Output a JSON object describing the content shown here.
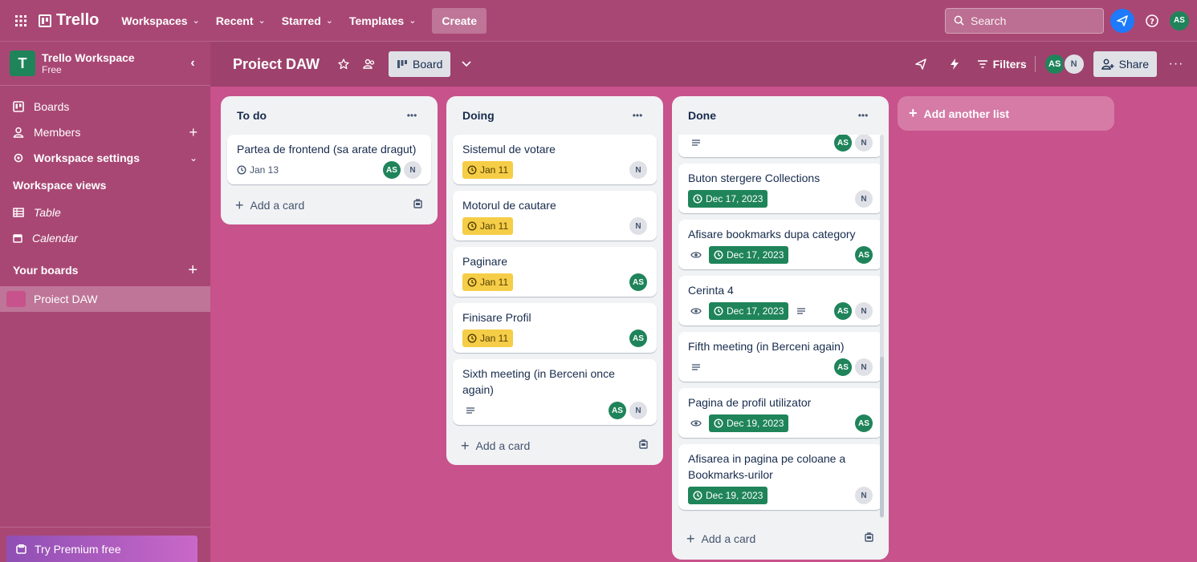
{
  "topbar": {
    "logo": "Trello",
    "nav": [
      "Workspaces",
      "Recent",
      "Starred",
      "Templates"
    ],
    "create_label": "Create",
    "search_placeholder": "Search",
    "user_initials": "AS"
  },
  "sidebar": {
    "workspace_name": "Trello Workspace",
    "workspace_plan": "Free",
    "workspace_initial": "T",
    "items": [
      {
        "label": "Boards",
        "icon": "trello-board-icon"
      },
      {
        "label": "Members",
        "icon": "person-icon"
      },
      {
        "label": "Workspace settings",
        "icon": "gear-icon"
      }
    ],
    "views_heading": "Workspace views",
    "views": [
      {
        "label": "Table",
        "icon": "table-icon"
      },
      {
        "label": "Calendar",
        "icon": "calendar-icon"
      }
    ],
    "boards_heading": "Your boards",
    "boards": [
      {
        "label": "Proiect DAW"
      }
    ],
    "premium_label": "Try Premium free"
  },
  "board": {
    "title": "Proiect DAW",
    "view_label": "Board",
    "filters_label": "Filters",
    "members": [
      "AS",
      "N"
    ],
    "share_label": "Share"
  },
  "lists": [
    {
      "title": "To do",
      "cards": [
        {
          "title": "Partea de frontend (sa arate dragut)",
          "date": "Jan 13",
          "date_style": "plain",
          "members": [
            "AS",
            "N"
          ]
        }
      ],
      "add_label": "Add a card"
    },
    {
      "title": "Doing",
      "cards": [
        {
          "title": "Sistemul de votare",
          "date": "Jan 11",
          "date_style": "due-soon",
          "members": [
            "N"
          ]
        },
        {
          "title": "Motorul de cautare",
          "date": "Jan 11",
          "date_style": "due-soon",
          "members": [
            "N"
          ]
        },
        {
          "title": "Paginare",
          "date": "Jan 11",
          "date_style": "due-soon",
          "members": [
            "AS"
          ]
        },
        {
          "title": "Finisare Profil",
          "date": "Jan 11",
          "date_style": "due-soon",
          "members": [
            "AS"
          ]
        },
        {
          "title": "Sixth meeting (in Berceni once again)",
          "description": true,
          "members": [
            "AS",
            "N"
          ]
        }
      ],
      "add_label": "Add a card"
    },
    {
      "title": "Done",
      "cards": [
        {
          "title": "",
          "description": true,
          "members": [
            "AS",
            "N"
          ]
        },
        {
          "title": "Buton stergere Collections",
          "date": "Dec 17, 2023",
          "date_style": "complete",
          "members": [
            "N"
          ]
        },
        {
          "title": "Afisare bookmarks dupa category",
          "watch": true,
          "date": "Dec 17, 2023",
          "date_style": "complete",
          "members": [
            "AS"
          ]
        },
        {
          "title": "Cerinta 4",
          "watch": true,
          "date": "Dec 17, 2023",
          "date_style": "complete",
          "description": true,
          "members": [
            "AS",
            "N"
          ]
        },
        {
          "title": "Fifth meeting (in Berceni again)",
          "description": true,
          "members": [
            "AS",
            "N"
          ]
        },
        {
          "title": "Pagina de profil utilizator",
          "watch": true,
          "date": "Dec 19, 2023",
          "date_style": "complete",
          "members": [
            "AS"
          ]
        },
        {
          "title": "Afisarea in pagina pe coloane a Bookmarks-urilor",
          "date": "Dec 19, 2023",
          "date_style": "complete",
          "members": [
            "N"
          ]
        }
      ],
      "add_label": "Add a card"
    }
  ],
  "add_list_label": "Add another list",
  "colors": {
    "board_bg": "#c8528b",
    "nav_bg": "#a94774",
    "due_soon": "#f5cd47",
    "complete": "#1f845a",
    "avatar_as": "#1f845a"
  }
}
